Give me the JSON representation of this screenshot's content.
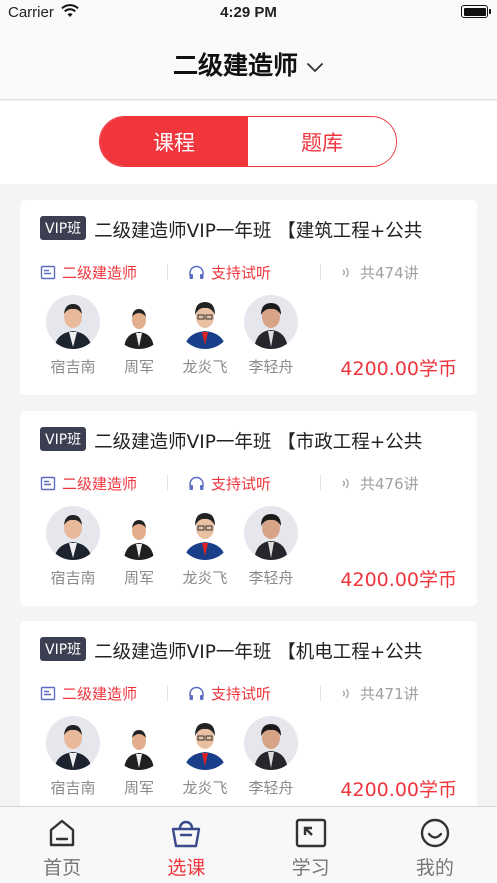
{
  "status_bar": {
    "carrier": "Carrier",
    "time": "4:29 PM"
  },
  "nav": {
    "title": "二级建造师"
  },
  "segments": [
    {
      "label": "课程",
      "active": true
    },
    {
      "label": "题库",
      "active": false
    }
  ],
  "courses": [
    {
      "badge": "VIP班",
      "title": "二级建造师VIP一年班 【建筑工程+公共",
      "category": "二级建造师",
      "trial": "支持试听",
      "lessons": "共474讲",
      "teachers": [
        "宿吉南",
        "周军",
        "龙炎飞",
        "李轻舟"
      ],
      "price": "4200.00学币"
    },
    {
      "badge": "VIP班",
      "title": "二级建造师VIP一年班 【市政工程+公共",
      "category": "二级建造师",
      "trial": "支持试听",
      "lessons": "共476讲",
      "teachers": [
        "宿吉南",
        "周军",
        "龙炎飞",
        "李轻舟"
      ],
      "price": "4200.00学币"
    },
    {
      "badge": "VIP班",
      "title": "二级建造师VIP一年班 【机电工程+公共",
      "category": "二级建造师",
      "trial": "支持试听",
      "lessons": "共471讲",
      "teachers": [
        "宿吉南",
        "周军",
        "龙炎飞",
        "李轻舟"
      ],
      "price": "4200.00学币"
    }
  ],
  "tabs": [
    {
      "label": "首页",
      "icon": "home-icon",
      "active": false
    },
    {
      "label": "选课",
      "icon": "basket-icon",
      "active": true
    },
    {
      "label": "学习",
      "icon": "study-icon",
      "active": false
    },
    {
      "label": "我的",
      "icon": "profile-icon",
      "active": false
    }
  ],
  "colors": {
    "accent": "#f0353d",
    "badge": "#3c3f52",
    "muted": "#8a8a8a",
    "category_icon": "#5b6cc4"
  }
}
